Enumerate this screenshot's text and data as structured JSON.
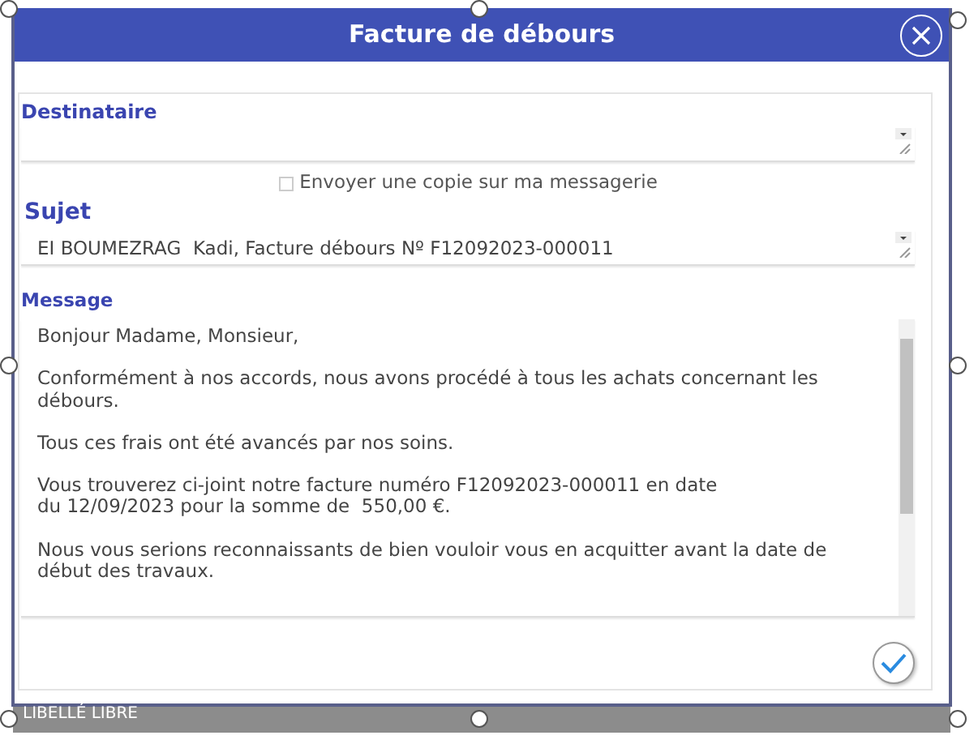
{
  "dialog": {
    "title": "Facture de débours"
  },
  "recipient": {
    "label": "Destinataire"
  },
  "copy_option": {
    "label": "Envoyer une copie sur ma messagerie",
    "checked": false
  },
  "subject": {
    "label": "Sujet",
    "value": "EI BOUMEZRAG  Kadi, Facture débours Nº F12092023-000011"
  },
  "message": {
    "label": "Message",
    "paragraphs": [
      "Bonjour Madame, Monsieur,",
      "Conformément à nos accords, nous avons procédé à tous les achats concernant les débours.",
      "Tous ces frais ont été avancés par nos soins.",
      "Vous trouverez ci-joint notre facture numéro F12092023-000011 en date\ndu 12/09/2023 pour la somme de  550,00 €.",
      "Nous vous serions reconnaissants de bien vouloir vous en acquitter avant la date de début des travaux."
    ]
  },
  "background": {
    "label": "LIBELLÉ LIBRE"
  }
}
